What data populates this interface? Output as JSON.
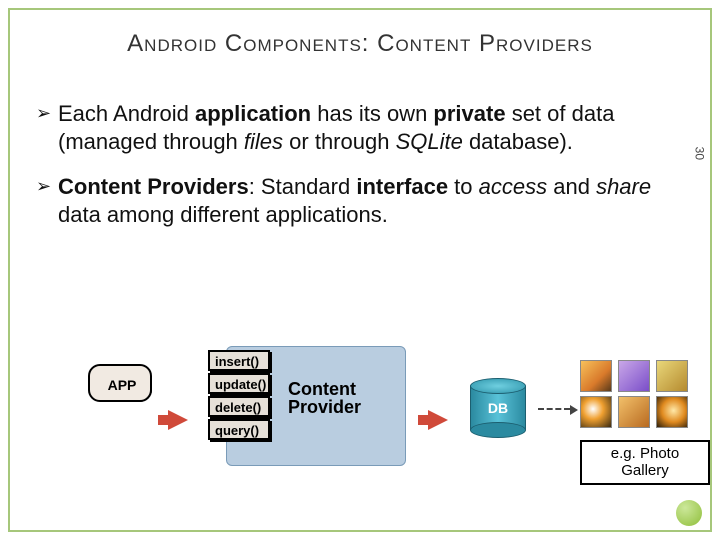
{
  "title": "Android Components: Content Providers",
  "page_number": "30",
  "bullets": [
    {
      "pre": "Each ",
      "k1": "Android ",
      "k2": "application ",
      "mid1": "has its own ",
      "k3": "private ",
      "mid2": "set of data ",
      "paren1": "(managed through ",
      "i1": "files ",
      "mid3": "or through ",
      "i2": "SQLite ",
      "post": "database)."
    },
    {
      "k1": "Content ",
      "k2": "Providers",
      "mid1": ": Standard ",
      "k3": "interface ",
      "mid2": "to ",
      "i1": "access ",
      "mid3": "and ",
      "i2": "share ",
      "post": "data among different applications."
    }
  ],
  "diagram": {
    "app_label": "APP",
    "methods": [
      "insert()",
      "update()",
      "delete()",
      "query()"
    ],
    "cp_label": "Content Provider",
    "db_label": "DB",
    "caption": "e.g. Photo Gallery"
  }
}
